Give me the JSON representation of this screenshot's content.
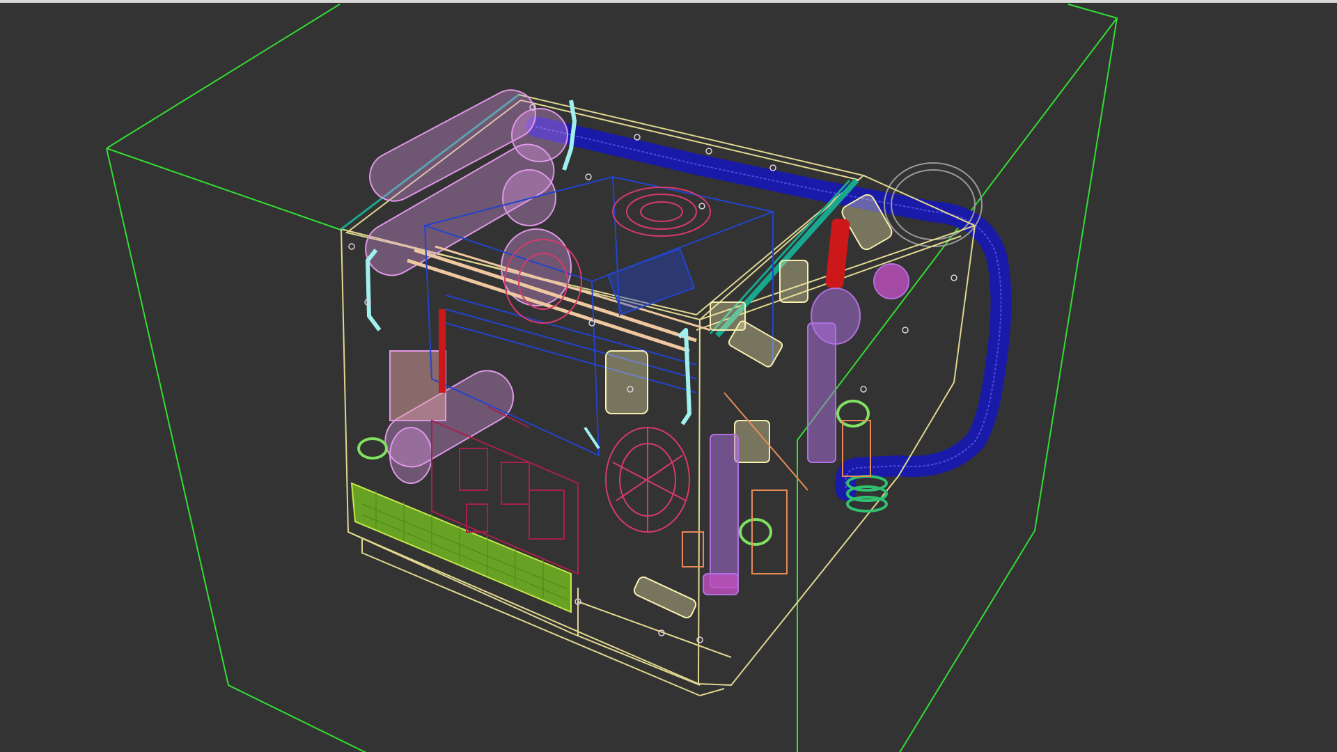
{
  "viewport": {
    "kind": "3D wireframe viewport",
    "background_color": "#333333",
    "top_border_color": "#d8d8d8"
  },
  "colors": {
    "bounding_box": "#33dd33",
    "chassis": "#e0d890",
    "hose": "#1a1aa8",
    "pink_parts": "#e098e8",
    "teal_rail": "#18a890",
    "red_fan": "#d83a6a",
    "green_grille": "#7ac820",
    "magenta_parts": "#c050c0",
    "lime_parts": "#80e060",
    "blue_frame": "#2244cc",
    "orange_parts": "#e88a5a",
    "cyan_parts": "#a0f0f0",
    "light_yellow_parts": "#f8f0b0",
    "red_parts": "#cc1818",
    "violet_parts": "#b070e0",
    "gray_hoop": "#9a9a9a"
  }
}
